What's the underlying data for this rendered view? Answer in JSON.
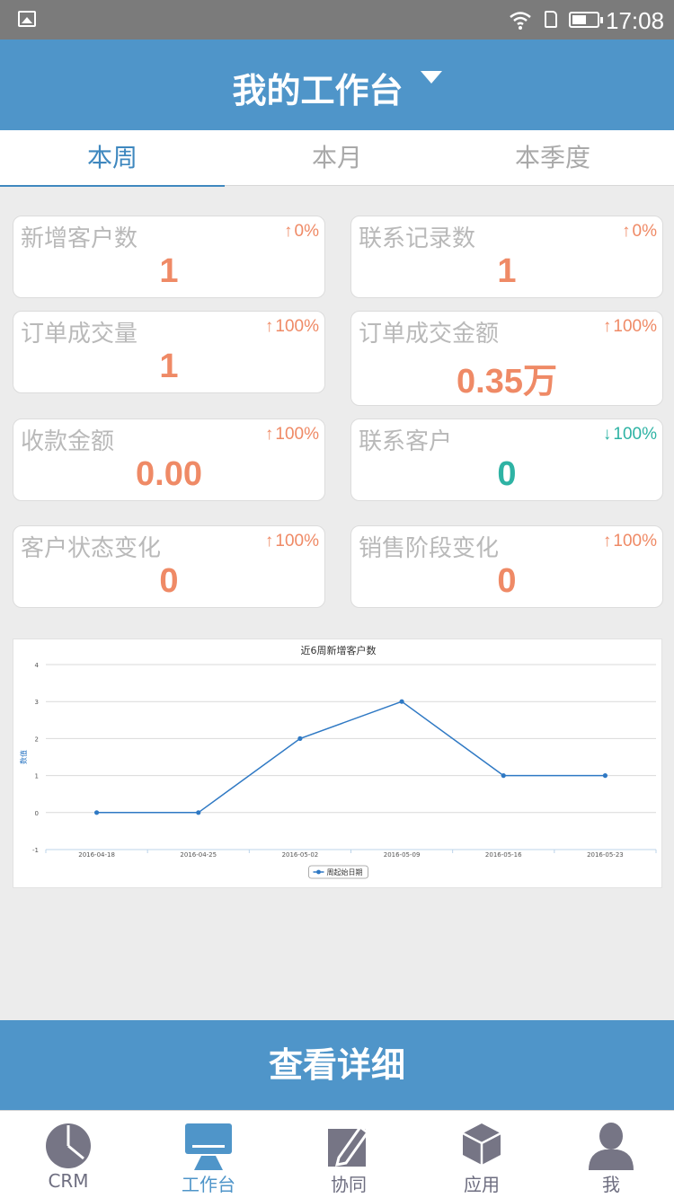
{
  "status_bar": {
    "time": "17:08"
  },
  "header": {
    "title": "我的工作台"
  },
  "tabs": [
    {
      "label": "本周",
      "active": true
    },
    {
      "label": "本月",
      "active": false
    },
    {
      "label": "本季度",
      "active": false
    }
  ],
  "metrics": [
    {
      "label": "新增客户数",
      "trend": "up",
      "change": "0%",
      "value": "1",
      "color": "#ef8a66"
    },
    {
      "label": "联系记录数",
      "trend": "up",
      "change": "0%",
      "value": "1",
      "color": "#ef8a66"
    },
    {
      "label": "订单成交量",
      "trend": "up",
      "change": "100%",
      "value": "1",
      "color": "#ef8a66"
    },
    {
      "label": "订单成交金额",
      "trend": "up",
      "change": "100%",
      "value": "0.35万",
      "color": "#ef8a66"
    },
    {
      "label": "收款金额",
      "trend": "up",
      "change": "100%",
      "value": "0.00",
      "color": "#ef8a66"
    },
    {
      "label": "联系客户",
      "trend": "down",
      "change": "100%",
      "value": "0",
      "color": "#2eb3a4"
    },
    {
      "label": "客户状态变化",
      "trend": "up",
      "change": "100%",
      "value": "0",
      "color": "#ef8a66"
    },
    {
      "label": "销售阶段变化",
      "trend": "up",
      "change": "100%",
      "value": "0",
      "color": "#ef8a66"
    }
  ],
  "chart_data": {
    "type": "line",
    "title": "近6周新增客户数",
    "ylabel": "数值",
    "xlabel": "",
    "categories": [
      "2016-04-18",
      "2016-04-25",
      "2016-05-02",
      "2016-05-09",
      "2016-05-16",
      "2016-05-23"
    ],
    "series": [
      {
        "name": "周起始日期",
        "values": [
          0,
          0,
          2,
          3,
          1,
          1
        ]
      }
    ],
    "ylim": [
      -1,
      4
    ],
    "yticks": [
      -1,
      0,
      1,
      2,
      3,
      4
    ],
    "grid": true,
    "legend_position": "bottom",
    "color": "#2f79c4"
  },
  "detail_button": {
    "label": "查看详细"
  },
  "bottom_nav": [
    {
      "label": "CRM",
      "icon": "pie-chart-icon",
      "active": false
    },
    {
      "label": "工作台",
      "icon": "monitor-icon",
      "active": true
    },
    {
      "label": "协同",
      "icon": "pencil-doc-icon",
      "active": false
    },
    {
      "label": "应用",
      "icon": "cube-icon",
      "active": false
    },
    {
      "label": "我",
      "icon": "user-icon",
      "active": false
    }
  ],
  "colors": {
    "primary": "#4f95c9",
    "accent_up": "#ef8a66",
    "accent_down": "#2eb3a4"
  }
}
